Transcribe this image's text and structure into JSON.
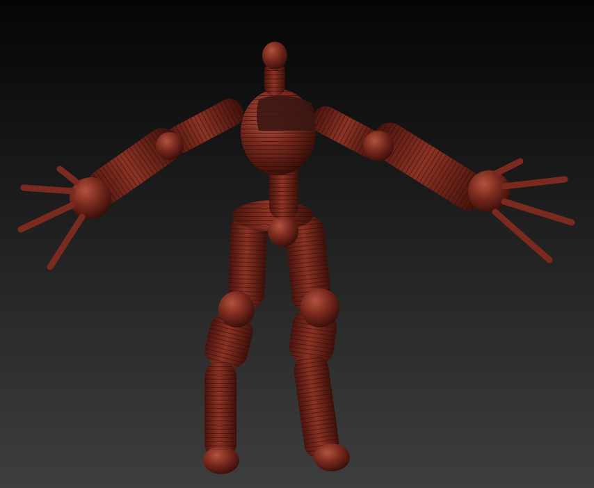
{
  "viewport": {
    "name": "3d-sculpt-viewport",
    "background_top": "#050505",
    "background_bottom": "#3e3e3e"
  },
  "model": {
    "name": "zsphere-armature-figure",
    "material_color": "#7a2a1e",
    "material_highlight": "#b0503c",
    "material_shadow": "#3a0f0a",
    "selected_segment_color": "#3b1612"
  }
}
